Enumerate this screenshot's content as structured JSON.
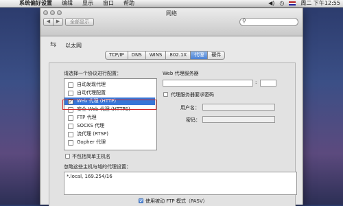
{
  "menubar": {
    "apple_icon": "",
    "app_name": "系统偏好设置",
    "menus": [
      "编辑",
      "显示",
      "窗口",
      "帮助"
    ],
    "clock": "周二 下午12:55"
  },
  "window": {
    "title": "网络",
    "show_all": "全部显示",
    "network_name": "以太网"
  },
  "tabs": [
    {
      "label": "TCP/IP",
      "active": false
    },
    {
      "label": "DNS",
      "active": false
    },
    {
      "label": "WINS",
      "active": false
    },
    {
      "label": "802.1X",
      "active": false
    },
    {
      "label": "代理",
      "active": true
    },
    {
      "label": "硬件",
      "active": false
    }
  ],
  "proxy": {
    "select_label": "请选择一个协议进行配置：",
    "protocols": [
      {
        "label": "自动发现代理",
        "checked": false,
        "selected": false
      },
      {
        "label": "自动代理配置",
        "checked": false,
        "selected": false
      },
      {
        "label": "Web 代理 (HTTP)",
        "checked": true,
        "selected": true
      },
      {
        "label": "安全 Web 代理 (HTTPS)",
        "checked": false,
        "selected": false
      },
      {
        "label": "FTP 代理",
        "checked": false,
        "selected": false
      },
      {
        "label": "SOCKS 代理",
        "checked": false,
        "selected": false
      },
      {
        "label": "流代理 (RTSP)",
        "checked": false,
        "selected": false
      },
      {
        "label": "Gopher 代理",
        "checked": false,
        "selected": false
      }
    ],
    "server_label": "Web 代理服务器",
    "colon": ":",
    "password_required": "代理服务器要求密码",
    "username_label": "用户名：",
    "password_label": "密码：",
    "exclude_simple": "不包括简单主机名",
    "bypass_label": "忽略这些主机与域的代理设置：",
    "bypass_value": "*.local, 169.254/16",
    "passive_ftp": "使用被动 FTP 模式（PASV）",
    "passive_ftp_checked": true
  }
}
